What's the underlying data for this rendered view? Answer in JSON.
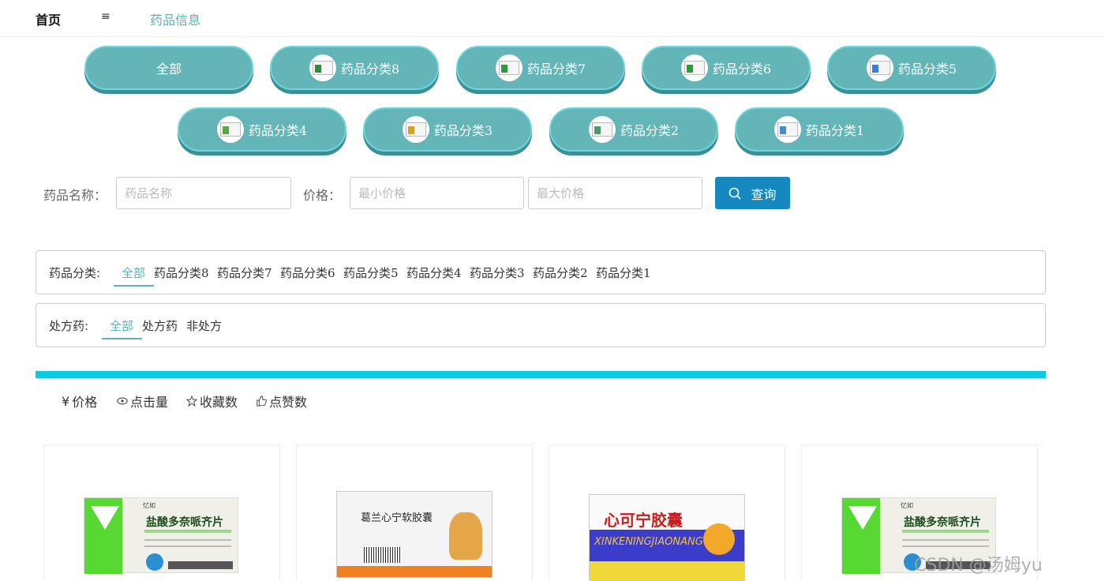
{
  "nav": {
    "home": "首页",
    "menu_icon": "≡",
    "drug_info": "药品信息"
  },
  "categories": [
    {
      "label": "全部",
      "thumb": false
    },
    {
      "label": "药品分类8",
      "thumb": true,
      "accent": "#2e8b3a"
    },
    {
      "label": "药品分类7",
      "thumb": true,
      "accent": "#2e9a3a"
    },
    {
      "label": "药品分类6",
      "thumb": true,
      "accent": "#2e9a3a"
    },
    {
      "label": "药品分类5",
      "thumb": true,
      "accent": "#3a7fc9"
    },
    {
      "label": "药品分类4",
      "thumb": true,
      "accent": "#5aa844"
    },
    {
      "label": "药品分类3",
      "thumb": true,
      "accent": "#d8a21e"
    },
    {
      "label": "药品分类2",
      "thumb": true,
      "accent": "#4a9a6a"
    },
    {
      "label": "药品分类1",
      "thumb": true,
      "accent": "#4a8ac9"
    }
  ],
  "search": {
    "name_label": "药品名称：",
    "name_placeholder": "药品名称",
    "price_label": "价格：",
    "min_placeholder": "最小价格",
    "max_placeholder": "最大价格",
    "button_label": "查询"
  },
  "filters": {
    "category_label": "药品分类:",
    "category_items": [
      "全部",
      "药品分类8",
      "药品分类7",
      "药品分类6",
      "药品分类5",
      "药品分类4",
      "药品分类3",
      "药品分类2",
      "药品分类1"
    ],
    "rx_label": "处方药:",
    "rx_items": [
      "全部",
      "处方药",
      "非处方"
    ]
  },
  "sort": {
    "price": "价格",
    "price_symbol": "¥",
    "clicks": "点击量",
    "favorites": "收藏数",
    "likes": "点赞数"
  },
  "products": [
    {
      "name": "盐酸多奈哌齐片",
      "brand": "忆如",
      "style": "green"
    },
    {
      "name": "葛兰心宁软胶囊",
      "style": "white"
    },
    {
      "name": "心可宁胶囊",
      "pinyin": "XINKENINGJIAONANG",
      "style": "blue"
    },
    {
      "name": "盐酸多奈哌齐片",
      "brand": "忆如",
      "style": "green"
    }
  ],
  "watermark": "CSDN @汤姆yu",
  "colors": {
    "accent": "#5bb3b6",
    "pill": "#63b5b7",
    "bar": "#0bcbe0",
    "search_button": "#1588c0"
  }
}
